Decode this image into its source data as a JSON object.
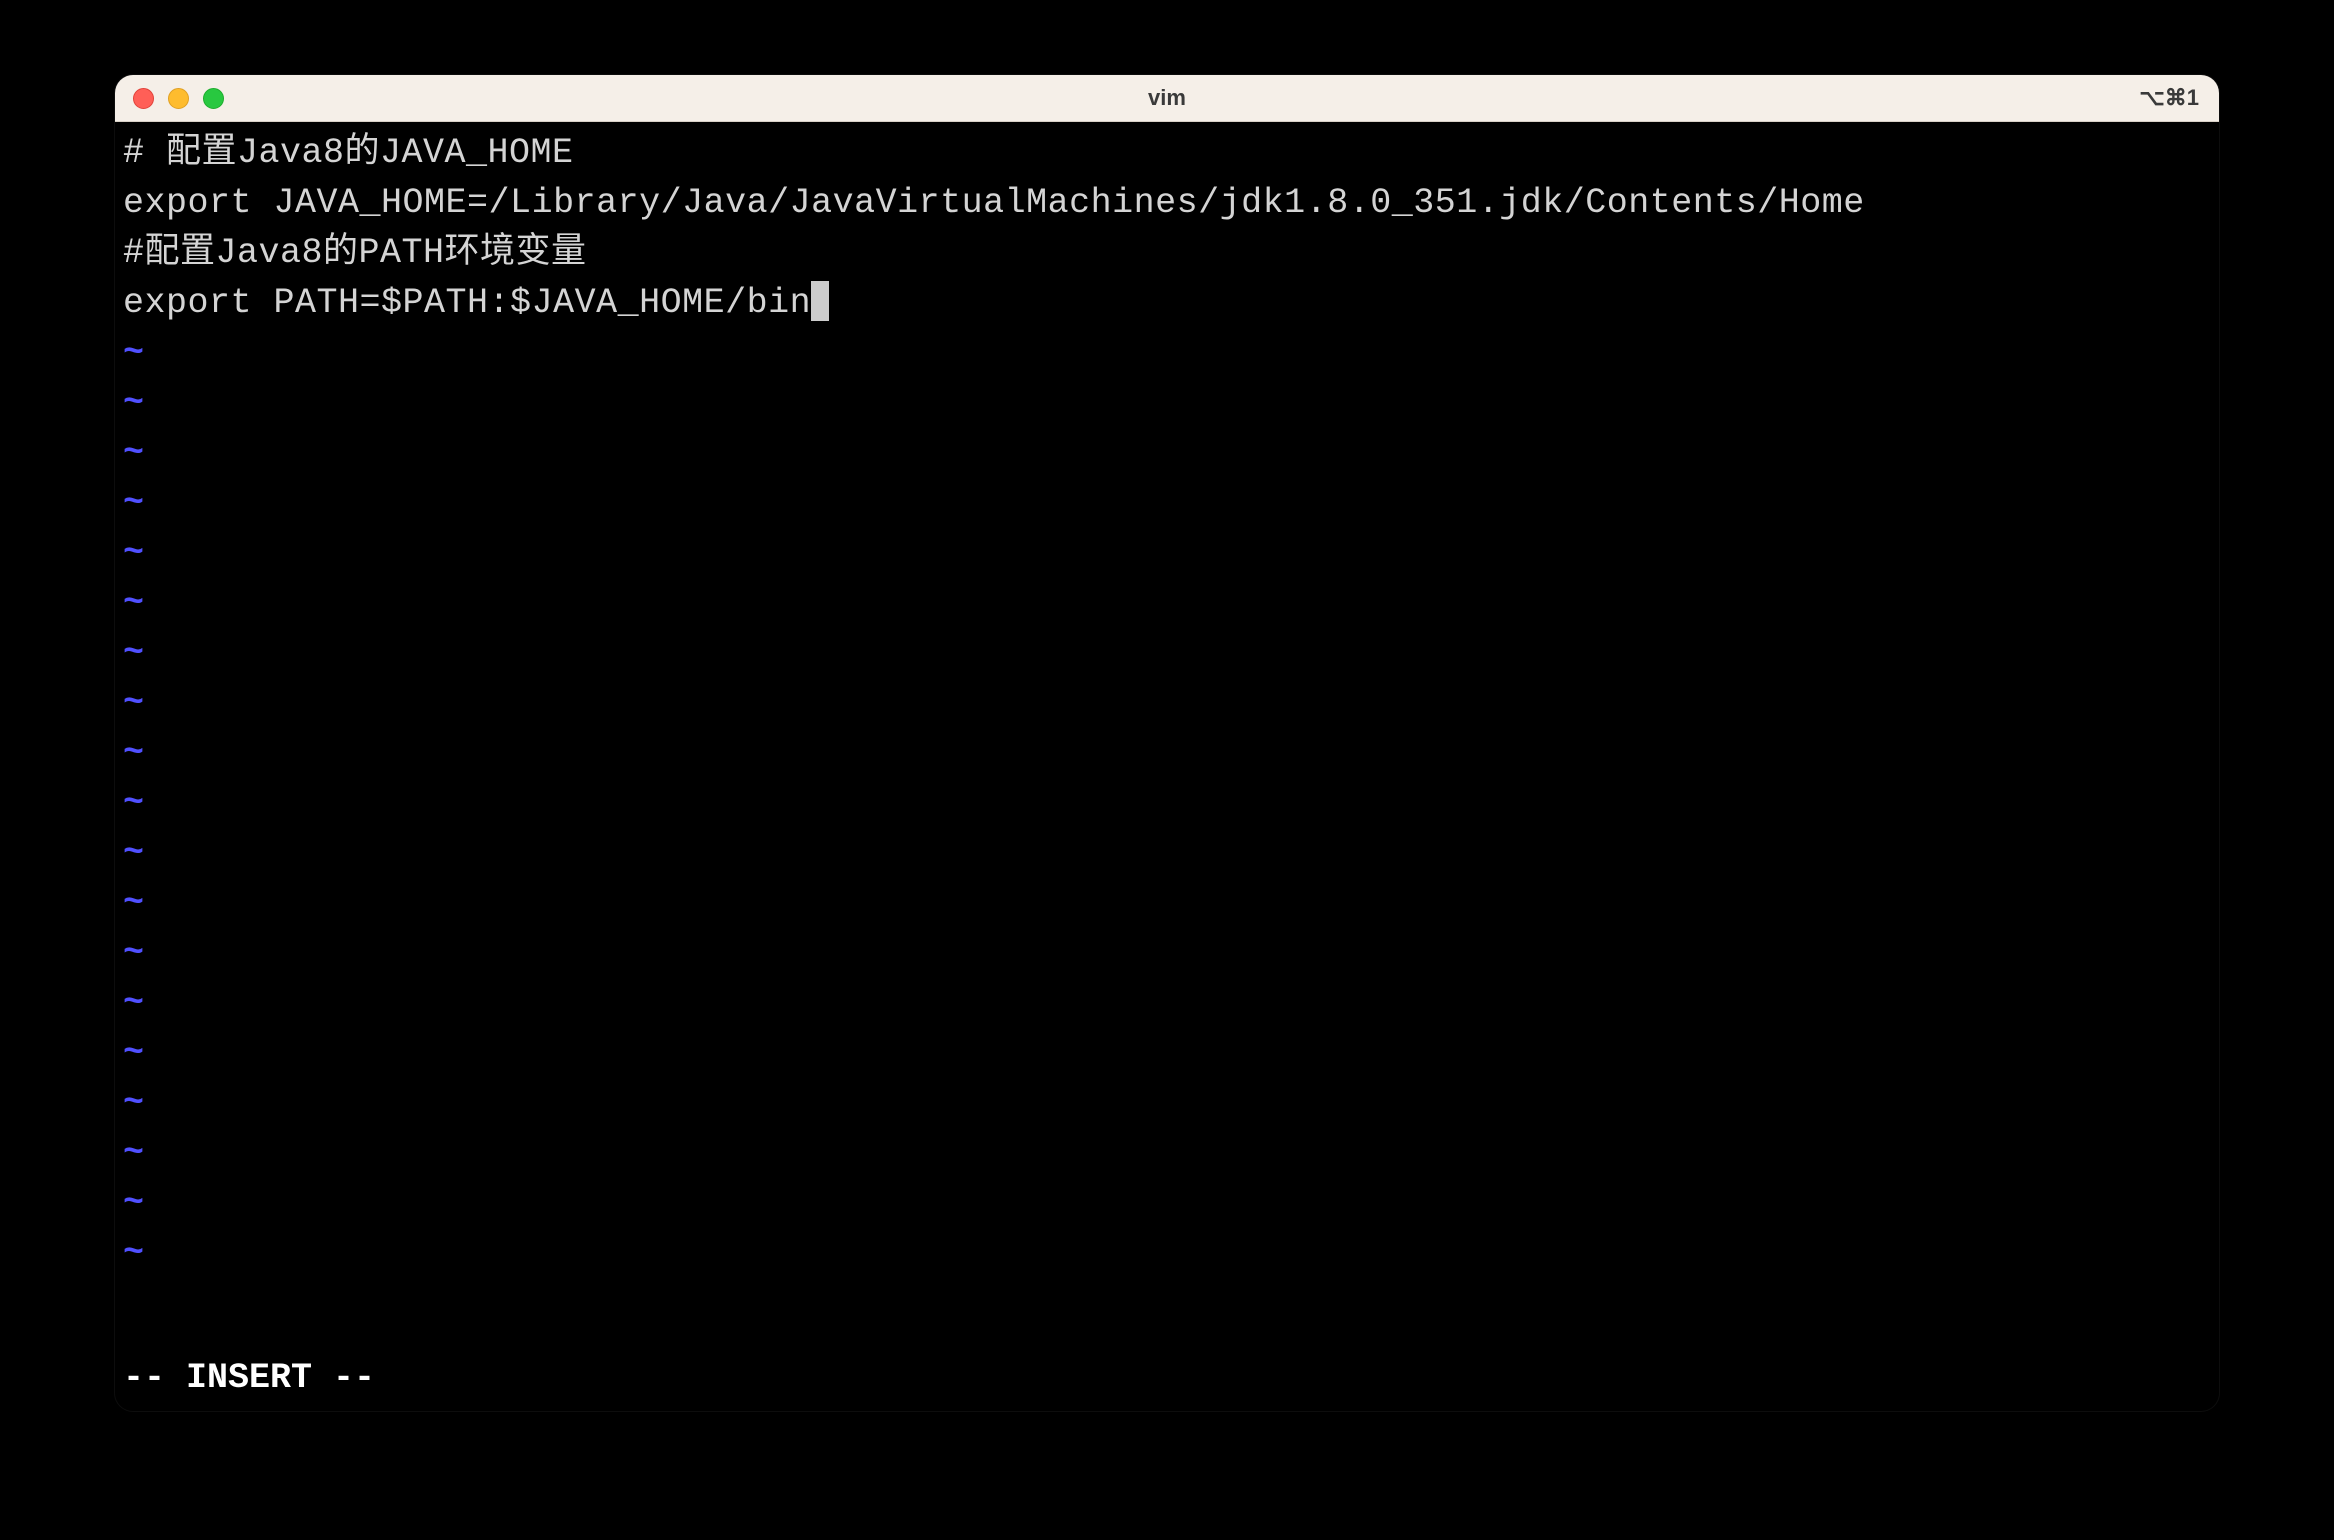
{
  "window": {
    "title": "vim",
    "shortcut": "⌥⌘1"
  },
  "editor": {
    "lines": [
      "# 配置Java8的JAVA_HOME",
      "export JAVA_HOME=/Library/Java/JavaVirtualMachines/jdk1.8.0_351.jdk/Contents/Home",
      "#配置Java8的PATH环境变量",
      "export PATH=$PATH:$JAVA_HOME/bin"
    ],
    "tilde_char": "~",
    "tilde_count": 19,
    "mode_line": "-- INSERT --"
  }
}
